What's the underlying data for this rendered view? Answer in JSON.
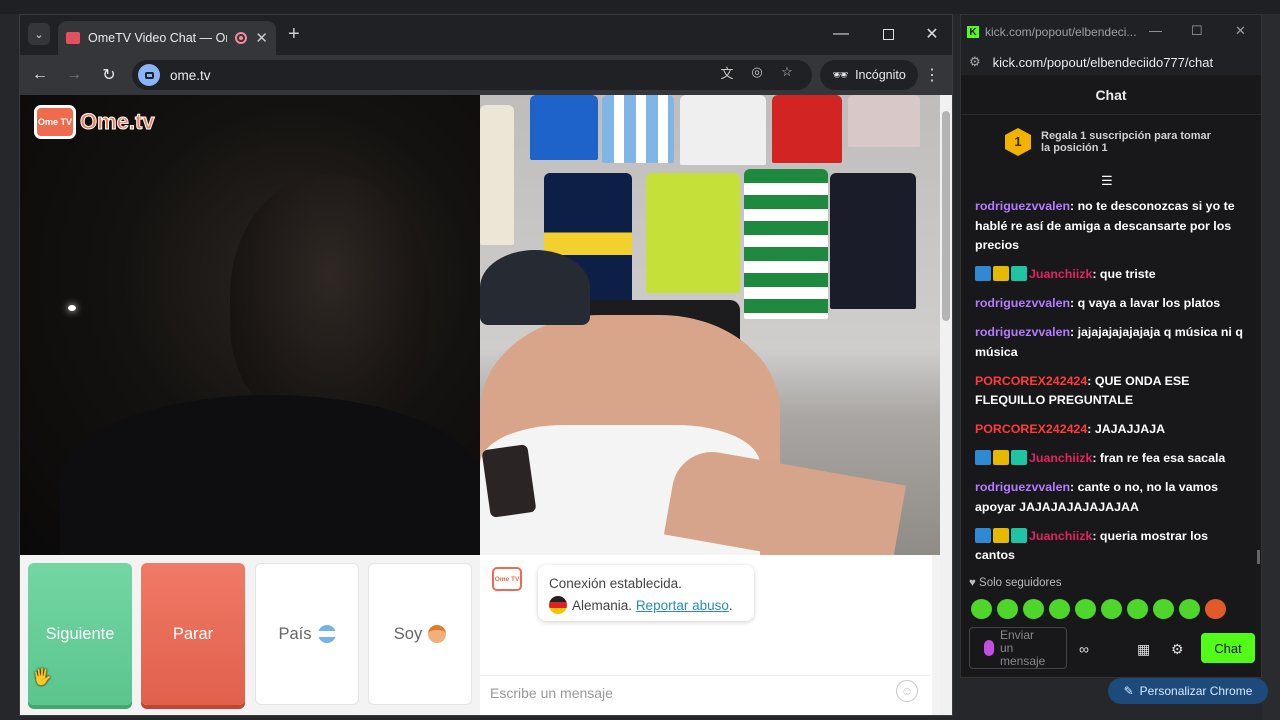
{
  "browser": {
    "tab_title": "OmeTV Video Chat — Ome",
    "url": "ome.tv",
    "incognito_label": "Incógnito",
    "tab_search_icon": "chevron-down-icon",
    "close_glyph": "✕",
    "new_tab_glyph": "+"
  },
  "page": {
    "logo_badge": "Ome TV",
    "logo_text": "Ome.tv",
    "buttons": {
      "next": "Siguiente",
      "stop": "Parar",
      "country": "País",
      "soy": "Soy"
    },
    "system_icon": "Ome TV",
    "system_line1": "Conexión establecida.",
    "system_country": "Alemania.",
    "report_link": "Reportar abuso",
    "report_suffix": ".",
    "message_placeholder": "Escribe un mensaje"
  },
  "kick": {
    "window_title": "kick.com/popout/elbendeci...",
    "url": "kick.com/popout/elbendeciido777/chat",
    "header": "Chat",
    "promo_rank": "1",
    "promo_text_1": "Regala 1 suscripción para tomar",
    "promo_text_2": "la posición 1",
    "messages": [
      {
        "user": "rodriguezvvalen",
        "color": "#b57bff",
        "badges": false,
        "text": ": no te desconozcas si yo te hablé re así de amiga a descansarte por los precios"
      },
      {
        "user": "Juanchiizk",
        "color": "#e0245e",
        "badges": true,
        "text": ": que triste"
      },
      {
        "user": "rodriguezvvalen",
        "color": "#b57bff",
        "badges": false,
        "text": ": q vaya a lavar los platos"
      },
      {
        "user": "rodriguezvvalen",
        "color": "#b57bff",
        "badges": false,
        "text": ": jajajajajajajaja q música ni q música"
      },
      {
        "user": "PORCOREX242424",
        "color": "#ff3b3b",
        "badges": false,
        "text": ": QUE ONDA ESE FLEQUILLO PREGUNTALE"
      },
      {
        "user": "PORCOREX242424",
        "color": "#ff3b3b",
        "badges": false,
        "text": ": JAJAJJAJA"
      },
      {
        "user": "Juanchiizk",
        "color": "#e0245e",
        "badges": true,
        "text": ": fran re fea esa sacala"
      },
      {
        "user": "rodriguezvvalen",
        "color": "#b57bff",
        "badges": false,
        "text": ": cante o no, no la vamos apoyar JAJAJAJAJAJAJAA"
      },
      {
        "user": "Juanchiizk",
        "color": "#e0245e",
        "badges": true,
        "text": ": queria mostrar los cantos"
      }
    ],
    "followers_only": "Solo seguidores",
    "input_placeholder": "Enviar un mensaje",
    "chat_button": "Chat"
  },
  "desktop": {
    "personalize": "Personalizar Chrome"
  },
  "colors": {
    "next": "#5bc58e",
    "stop": "#e1604b",
    "kick_green": "#53fc18"
  }
}
